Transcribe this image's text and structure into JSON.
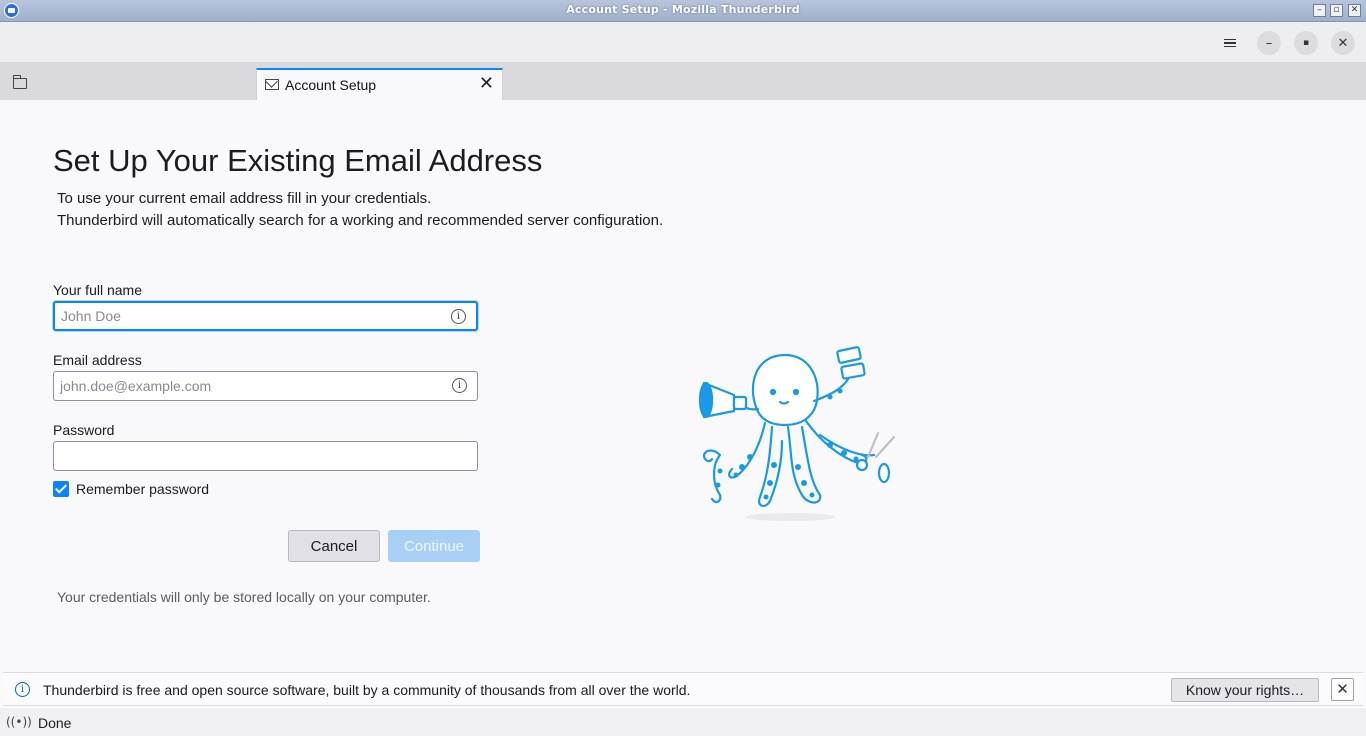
{
  "window": {
    "title": "Account Setup - Mozilla Thunderbird",
    "controls": {
      "minimize": "–",
      "maximize": "▫",
      "close": "✕"
    }
  },
  "toolbar": {
    "menu_icon": "hamburger-menu-icon",
    "minimize": "–",
    "restore": "▪",
    "close": "✕"
  },
  "tabs": [
    {
      "icon": "folder-icon",
      "label": ""
    },
    {
      "icon": "mail-setup-icon",
      "label": "Account Setup",
      "active": true,
      "close": "✕"
    }
  ],
  "main": {
    "heading": "Set Up Your Existing Email Address",
    "intro_line1": "To use your current email address fill in your credentials.",
    "intro_line2": "Thunderbird will automatically search for a working and recommended server configuration.",
    "full_name": {
      "label": "Your full name",
      "placeholder": "John Doe",
      "value": ""
    },
    "email": {
      "label": "Email address",
      "placeholder": "john.doe@example.com",
      "value": ""
    },
    "password": {
      "label": "Password",
      "value": ""
    },
    "remember_password": {
      "label": "Remember password",
      "checked": true
    },
    "cancel_label": "Cancel",
    "continue_label": "Continue",
    "local_note": "Your credentials will only be stored locally on your computer.",
    "info_glyph": "i"
  },
  "notification": {
    "text": "Thunderbird is free and open source software, built by a community of thousands from all over the world.",
    "button_label": "Know your rights…",
    "close": "✕",
    "icon_glyph": "i"
  },
  "status": {
    "icon": "((•))",
    "text": "Done"
  },
  "colors": {
    "accent": "#0a84ff",
    "illustration": "#1a9ae6",
    "continue_disabled": "#a8d0f7"
  }
}
